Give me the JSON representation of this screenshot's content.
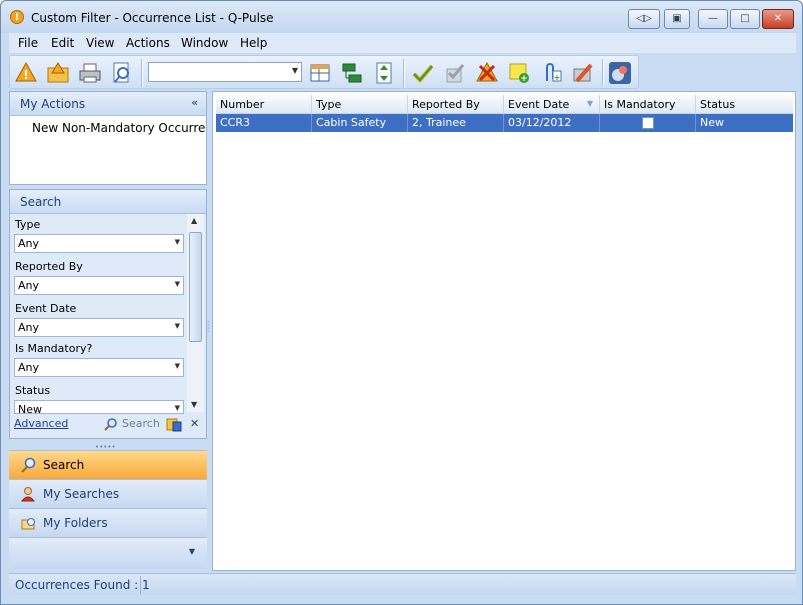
{
  "window": {
    "title": "Custom Filter - Occurrence List - Q-Pulse"
  },
  "menu": [
    {
      "label": "File"
    },
    {
      "label": "Edit"
    },
    {
      "label": "View"
    },
    {
      "label": "Actions"
    },
    {
      "label": "Window"
    },
    {
      "label": "Help"
    }
  ],
  "toolbar": {
    "combo_value": ""
  },
  "my_actions": {
    "title": "My Actions",
    "items": [
      "New Non-Mandatory Occurrence..."
    ]
  },
  "search": {
    "title": "Search",
    "fields": [
      {
        "label": "Type",
        "value": "Any"
      },
      {
        "label": "Reported By",
        "value": "Any"
      },
      {
        "label": "Event Date",
        "value": "Any"
      },
      {
        "label": "Is Mandatory?",
        "value": "Any"
      },
      {
        "label": "Status",
        "value": "New"
      }
    ],
    "advanced_label": "Advanced",
    "search_label": "Search",
    "clear_label": "✕"
  },
  "nav": [
    {
      "label": "Search",
      "active": true
    },
    {
      "label": "My Searches",
      "active": false
    },
    {
      "label": "My Folders",
      "active": false
    }
  ],
  "grid": {
    "columns": [
      "Number",
      "Type",
      "Reported By",
      "Event Date",
      "Is Mandatory",
      "Status"
    ],
    "rows": [
      {
        "number": "CCR3",
        "type": "Cabin Safety",
        "reported_by": "2, Trainee",
        "event_date": "03/12/2012",
        "is_mandatory": false,
        "status": "New"
      }
    ]
  },
  "status": {
    "text": "Occurrences Found : 1"
  },
  "colors": {
    "accent": "#3d6fc4",
    "nav_active": "#f9a93a",
    "frame": "#c9dcf3"
  }
}
